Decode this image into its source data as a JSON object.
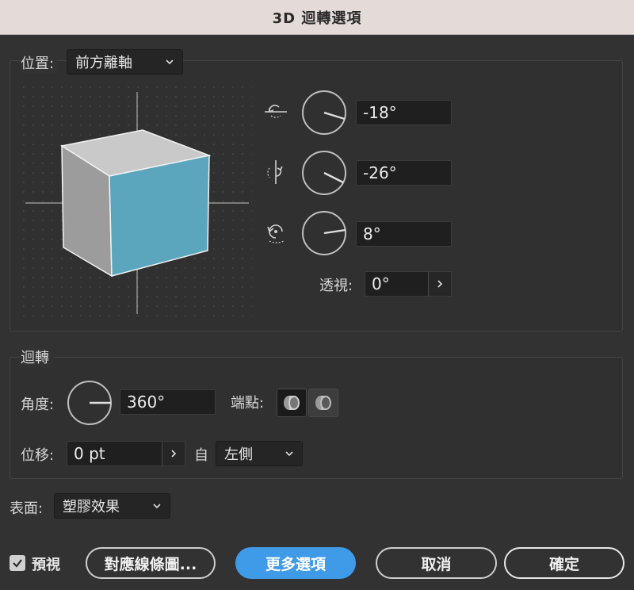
{
  "window": {
    "title": "3D 迴轉選項"
  },
  "position": {
    "label": "位置:",
    "preset_value": "前方離軸",
    "x_rotation": "-18°",
    "y_rotation": "-26°",
    "z_rotation": "8°",
    "perspective_label": "透視:",
    "perspective_value": "0°"
  },
  "revolve": {
    "section_label": "迴轉",
    "angle_label": "角度:",
    "angle_value": "360°",
    "cap_label": "端點:",
    "offset_label": "位移:",
    "offset_value": "0 pt",
    "from_label": "自",
    "from_value": "左側"
  },
  "surface": {
    "label": "表面:",
    "value": "塑膠效果"
  },
  "footer": {
    "preview_label": "預視",
    "preview_checked": true,
    "map_art_label": "對應線條圖...",
    "more_options_label": "更多選項",
    "cancel_label": "取消",
    "ok_label": "確定"
  },
  "icons": {
    "x_axis": "rotate-x-axis-icon",
    "y_axis": "rotate-y-axis-icon",
    "z_axis": "rotate-z-axis-icon",
    "cap_on": "cap-on-icon",
    "cap_off": "cap-off-icon",
    "chevron": "chevron-down-icon",
    "arrow": "chevron-right-icon"
  },
  "colors": {
    "cube_front": "#5ba6bd",
    "cube_side": "#9e9e9e",
    "cube_top": "#c8c8c8",
    "accent": "#3f9ae8"
  }
}
